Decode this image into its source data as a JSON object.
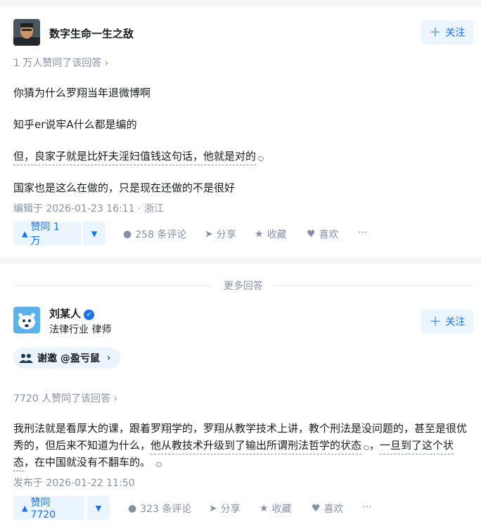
{
  "answer1": {
    "author_name": "数字生命一生之敌",
    "follow_label": "关注",
    "votes_text": "1 万人赞同了该回答 ›",
    "paragraphs": [
      "你猜为什么罗翔当年退微博啊",
      "知乎er说牢A什么都是编的",
      "但，良家子就是比奸夫淫妇值钱这句话，他就是对的",
      "国家也是这么在做的，只是现在还做的不是很好"
    ],
    "edited": "编辑于 2026-01-23 16:11 · 浙江",
    "vote_label": "赞同 1 万",
    "comments": "258 条评论",
    "share": "分享",
    "collect": "收藏",
    "like": "喜欢",
    "more": "···"
  },
  "more_answers_label": "更多回答",
  "answer2": {
    "author_name": "刘某人",
    "headline": "法律行业 律师",
    "follow_label": "关注",
    "invite_label": "谢邀 @盈亏鼠",
    "votes_text": "7720 人赞同了该回答 ›",
    "para_line1": "我刑法就是看厚大的课，跟着罗翔学的，罗翔从教学技术上讲，教个刑法是没问题的，甚至是很优",
    "para_line2_a": "秀的，但后来不知道为什么，",
    "para_line2_b": "他从教技术升级到了输出所谓刑法哲学的状态",
    "para_line2_c": "，",
    "para_line2_d": "一旦到了这个状",
    "para_line3_a": "态",
    "para_line3_b": "，在中国就没有不翻车的。",
    "published": "发布于 2026-01-22 11:50",
    "vote_label": "赞同 7720",
    "comments": "323 条评论",
    "share": "分享",
    "collect": "收藏",
    "like": "喜欢",
    "more": "···"
  }
}
